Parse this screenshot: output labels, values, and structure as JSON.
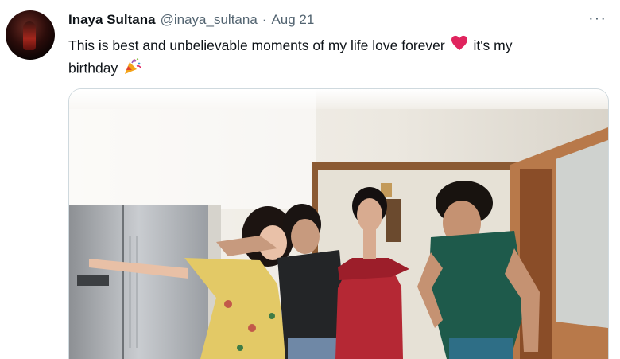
{
  "tweet": {
    "author_name": "Inaya Sultana",
    "handle": "@inaya_sultana",
    "separator": "·",
    "date": "Aug 21",
    "more_glyph": "···",
    "text_part1": "This is best and unbelievable moments of my life love forever",
    "text_part2": "it's my",
    "text_part3": "birthday",
    "emoji_1": "red-heart-icon",
    "emoji_2": "party-popper-icon"
  },
  "colors": {
    "text_primary": "#0f1419",
    "text_secondary": "#536471",
    "border": "#cfd9de",
    "heart": "#e0245e"
  },
  "media": {
    "type": "photo",
    "subject": "group-photo"
  }
}
